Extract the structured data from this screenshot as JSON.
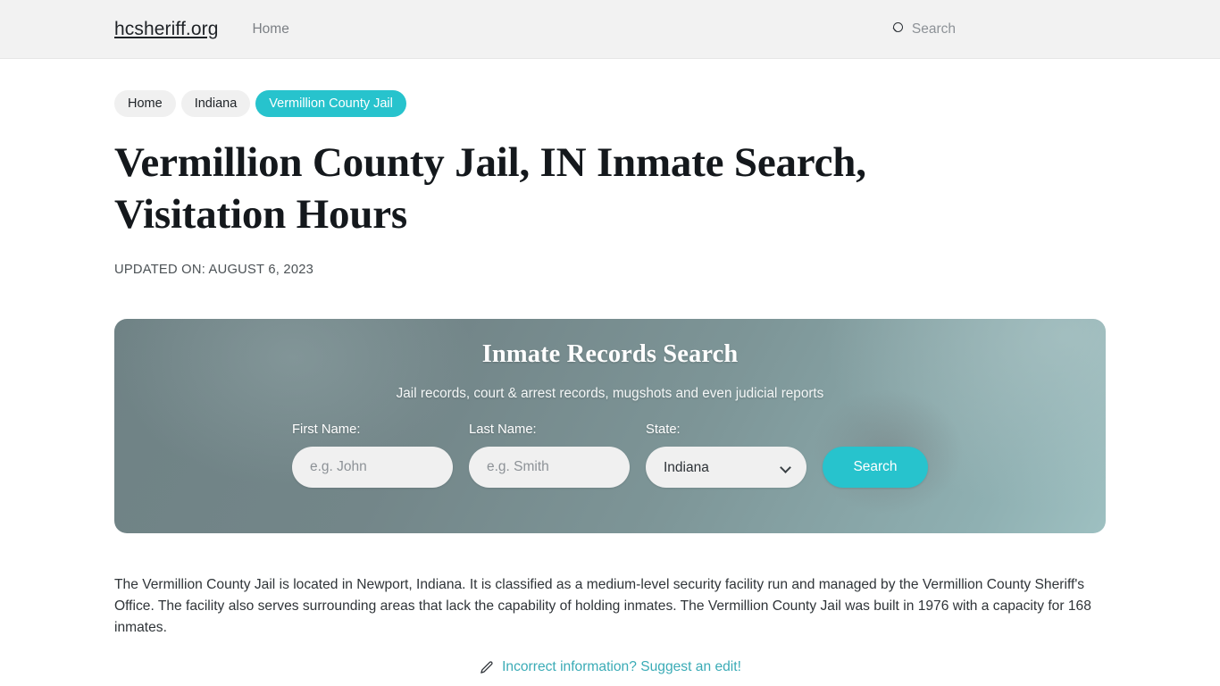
{
  "header": {
    "brand": "hcsheriff.org",
    "nav": [
      {
        "label": "Home"
      }
    ],
    "search": {
      "icon": "search-icon",
      "label": "Search"
    }
  },
  "breadcrumbs": [
    {
      "label": "Home",
      "current": false
    },
    {
      "label": "Indiana",
      "current": false
    },
    {
      "label": "Vermillion County Jail",
      "current": true
    }
  ],
  "article": {
    "title": "Vermillion County Jail, IN Inmate Search, Visitation Hours",
    "updated": "UPDATED ON: AUGUST 6, 2023",
    "paragraph": "The Vermillion County Jail is located in Newport, Indiana. It is classified as a medium-level security facility run and managed by the Vermillion County Sheriff's Office. The facility also serves surrounding areas that lack the capability of holding inmates. The Vermillion County Jail was built in 1976 with a capacity for 168 inmates."
  },
  "inmate_search_panel": {
    "title": "Inmate Records Search",
    "subtitle": "Jail records, court & arrest records, mugshots and even judicial reports",
    "fields": {
      "first_name": {
        "label": "First Name:",
        "value": "",
        "placeholder": "e.g. John"
      },
      "last_name": {
        "label": "Last Name:",
        "value": "",
        "placeholder": "e.g. Smith"
      },
      "state": {
        "label": "State:",
        "value": "Indiana",
        "options": [
          "Indiana"
        ]
      }
    },
    "submit_label": "Search"
  },
  "suggest_edit": {
    "icon": "pencil-icon",
    "label": "Incorrect information? Suggest an edit!"
  },
  "colors": {
    "accent_teal": "#27c3cd",
    "link_teal": "#3aabb6",
    "header_bg": "#f2f2f2",
    "panel_slate": "#7d9597",
    "input_bg": "#f0f0f0"
  }
}
